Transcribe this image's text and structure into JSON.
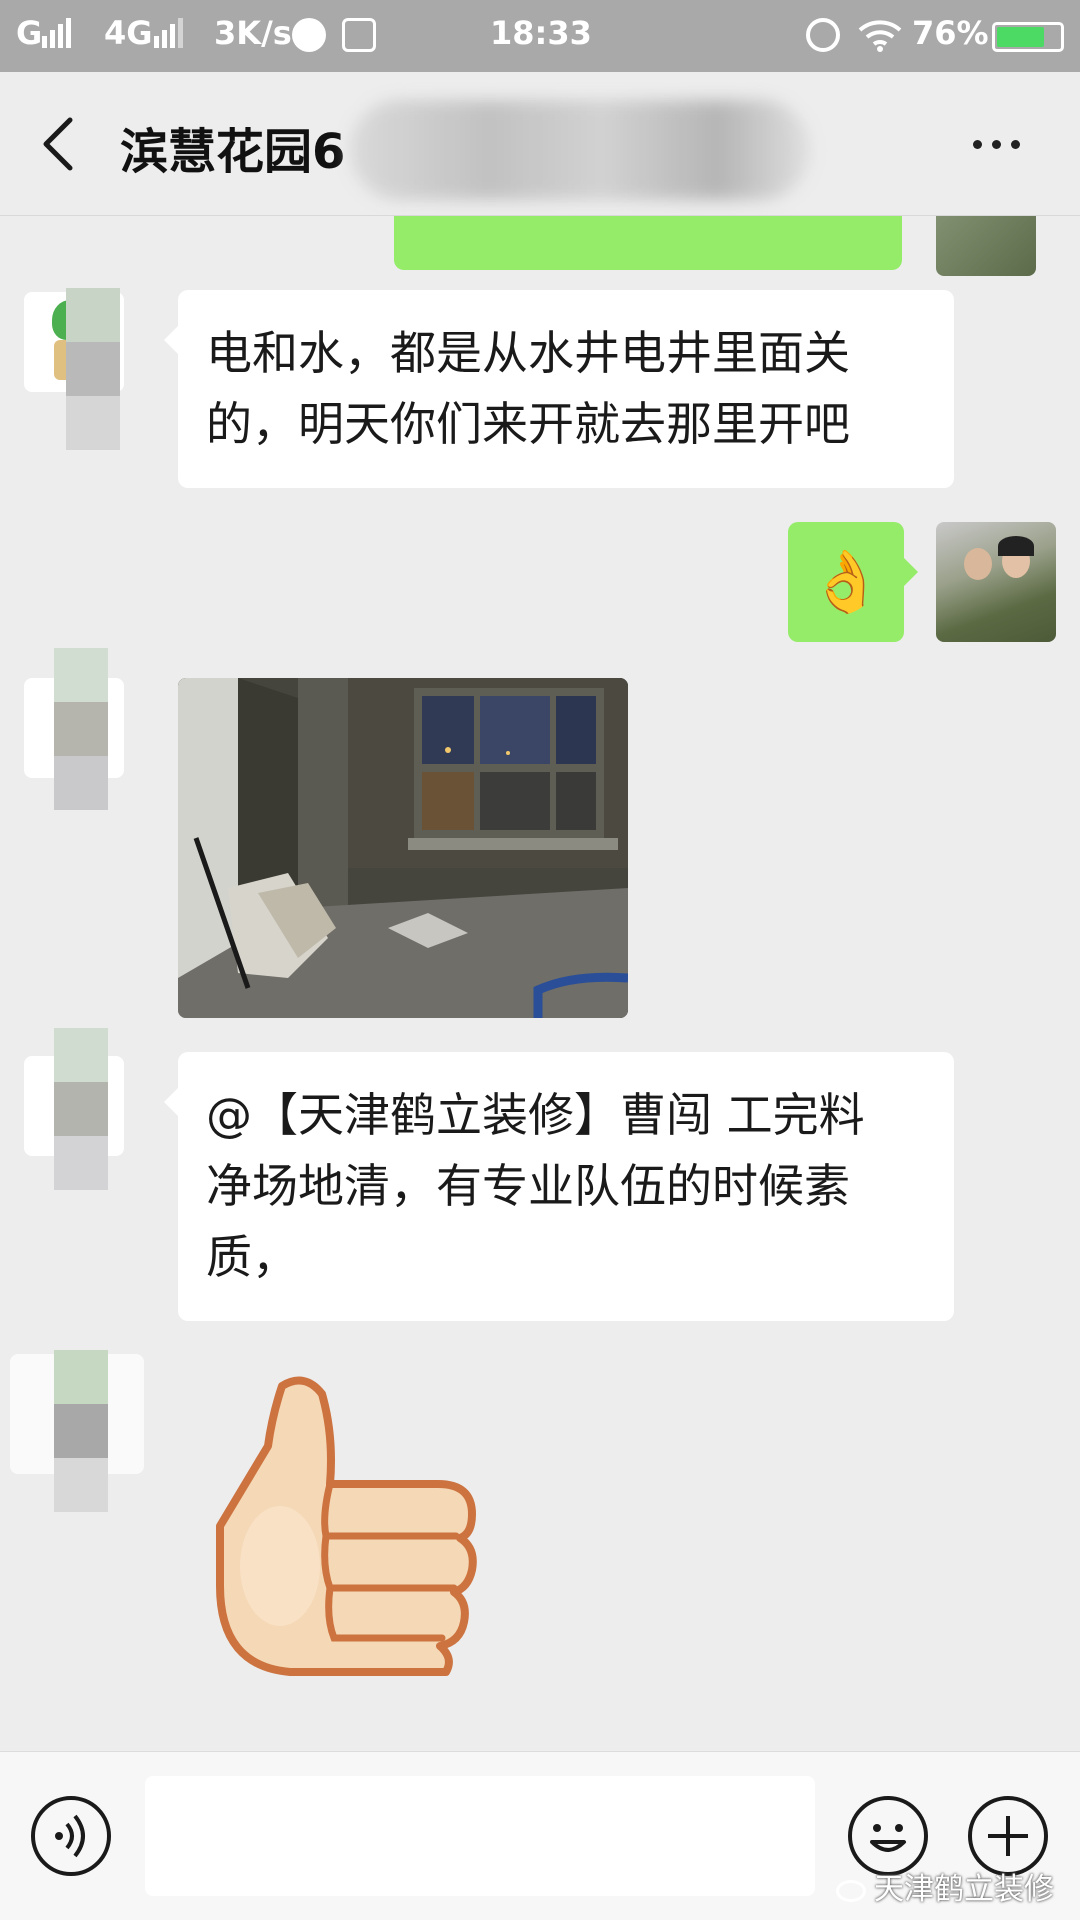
{
  "status_bar": {
    "carrier_g": "G",
    "network_4g": "4G",
    "speed": "3K/s",
    "time": "18:33",
    "battery_percent": "76%",
    "battery_level": 0.76,
    "icons": [
      "signal-icon",
      "browser-icon",
      "alipay-icon",
      "alarm-icon",
      "wifi-icon",
      "battery-icon"
    ]
  },
  "header": {
    "title": "滨慧花园6",
    "back_icon": "back-arrow-icon",
    "more_icon": "more-icon"
  },
  "messages": [
    {
      "side": "right",
      "type": "text",
      "content": ""
    },
    {
      "side": "left",
      "type": "text",
      "lines": [
        "电和水，都是从水井电井里面关",
        "的，明天你们来开就去那里开吧"
      ]
    },
    {
      "side": "right",
      "type": "emoji",
      "emoji": "👌"
    },
    {
      "side": "left",
      "type": "image",
      "image": "unfinished-room-photo"
    },
    {
      "side": "left",
      "type": "text",
      "lines": [
        "@【天津鹤立装修】曹闯  工完料",
        "净场地清，有专业队伍的时候素",
        "质，"
      ]
    },
    {
      "side": "left",
      "type": "sticker",
      "sticker": "thumbs-up-sticker"
    }
  ],
  "input_bar": {
    "voice_icon": "voice-icon",
    "emoji_icon": "emoji-icon",
    "plus_icon": "plus-icon"
  },
  "watermark": "天津鹤立装修",
  "colors": {
    "background": "#ededed",
    "bubble_self": "#95ec69",
    "bubble_other": "#ffffff",
    "status_bar": "#a9a9a9",
    "battery_fill": "#4cd964"
  }
}
